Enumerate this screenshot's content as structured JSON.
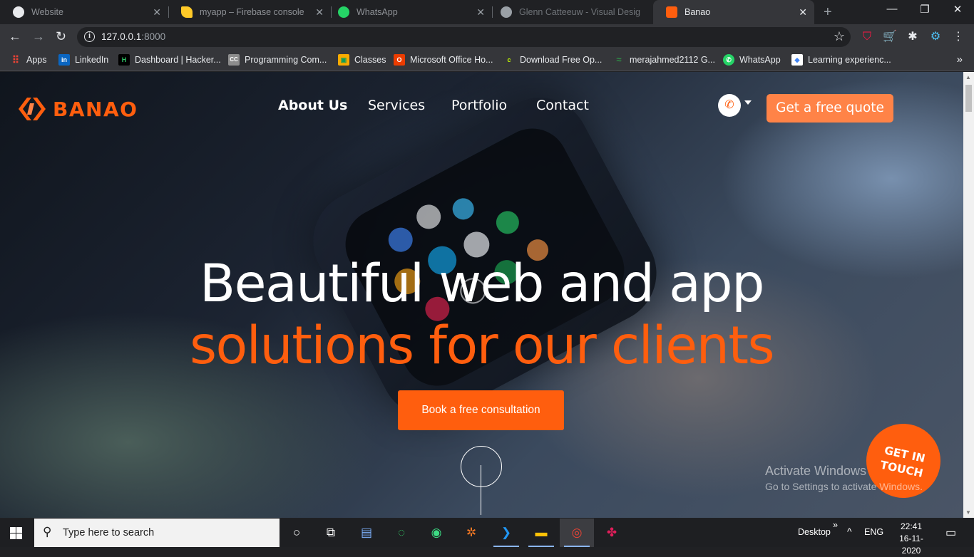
{
  "browser": {
    "tabs": [
      {
        "label": "Website",
        "favicon_color": "#e8eaed",
        "active": false
      },
      {
        "label": "myapp – Firebase console",
        "favicon_color": "#ffca28",
        "active": false
      },
      {
        "label": "WhatsApp",
        "favicon_color": "#25d366",
        "active": false
      },
      {
        "label": "Glenn Catteeuw - Visual Desig",
        "favicon_color": "#9aa0a6",
        "active": false
      },
      {
        "label": "Banao",
        "favicon_color": "#ff5e0e",
        "active": true
      }
    ],
    "close_glyph": "✕",
    "new_tab_glyph": "+",
    "window_controls": {
      "minimize": "—",
      "maximize": "❐",
      "close": "✕"
    },
    "nav": {
      "back": "←",
      "forward": "→",
      "reload": "↻"
    },
    "url_host": "127.0.0.1",
    "url_port": ":8000",
    "star_glyph": "☆",
    "extensions": [
      {
        "name": "shield-extension-icon",
        "glyph": "⛉",
        "color": "#ff1744"
      },
      {
        "name": "cart-extension-icon",
        "glyph": "🛒",
        "color": "#ff1744"
      },
      {
        "name": "puzzle-extension-icon",
        "glyph": "✱",
        "color": "#e8eaed"
      },
      {
        "name": "gear-extension-icon",
        "glyph": "⚙",
        "color": "#4fc3f7"
      },
      {
        "name": "menu-icon",
        "glyph": "⋮",
        "color": "#e8eaed"
      }
    ],
    "bookmarks": [
      {
        "label": "Apps",
        "icon_color": "#ea4335",
        "glyph": "⠿"
      },
      {
        "label": "LinkedIn",
        "icon_color": "#0a66c2",
        "glyph": "in"
      },
      {
        "label": "Dashboard | Hacker...",
        "icon_color": "#000000",
        "glyph": "H"
      },
      {
        "label": "Programming Com...",
        "icon_color": "#8d8d8d",
        "glyph": "CC"
      },
      {
        "label": "Classes",
        "icon_color": "#0f9d58",
        "glyph": "▣"
      },
      {
        "label": "Microsoft Office Ho...",
        "icon_color": "#eb3c00",
        "glyph": "O"
      },
      {
        "label": "Download Free Op...",
        "icon_color": "#35363a",
        "glyph": "c"
      },
      {
        "label": "merajahmed2112 G...",
        "icon_color": "#35363a",
        "glyph": "≈"
      },
      {
        "label": "WhatsApp",
        "icon_color": "#25d366",
        "glyph": "✆"
      },
      {
        "label": "Learning experienc...",
        "icon_color": "#ffffff",
        "glyph": "◆"
      }
    ],
    "bookmarks_more": "»"
  },
  "site": {
    "brand": "BANAO",
    "brand_color": "#ff5e0e",
    "nav": [
      "About Us",
      "Services",
      "Portfolio",
      "Contact"
    ],
    "phone_glyph": "✆",
    "quote_label": "Get a free quote",
    "hero_line1": "Beautiful web and app",
    "hero_line2": "solutions for our clients",
    "cta_label": "Book a free consultation",
    "get_in_touch_line1": "GET IN",
    "get_in_touch_line2": "TOUCH",
    "accent_color": "#ff5e0e"
  },
  "watermark": {
    "line1": "Activate Windows",
    "line2": "Go to Settings to activate Windows."
  },
  "taskbar": {
    "search_placeholder": "Type here to search",
    "search_glyph": "⚲",
    "cortana_glyph": "○",
    "taskview_glyph": "⧉",
    "apps": [
      {
        "name": "notepad-app-icon",
        "glyph": "▤",
        "color": "#7fb3ff"
      },
      {
        "name": "circle-app-icon",
        "glyph": "◌",
        "color": "#33cc66"
      },
      {
        "name": "android-studio-app-icon",
        "glyph": "◉",
        "color": "#3ddc84"
      },
      {
        "name": "xampp-app-icon",
        "glyph": "✲",
        "color": "#fb7a24"
      },
      {
        "name": "vscode-app-icon",
        "glyph": "❯",
        "color": "#2196f3"
      },
      {
        "name": "file-explorer-app-icon",
        "glyph": "▬",
        "color": "#ffc107"
      },
      {
        "name": "chrome-app-icon",
        "glyph": "◎",
        "color": "#ea4335"
      },
      {
        "name": "slack-app-icon",
        "glyph": "✤",
        "color": "#e01e5a"
      }
    ],
    "desktop_label": "Desktop",
    "chevron": "»",
    "tray_up": "^",
    "lang": "ENG",
    "time": "22:41",
    "date": "16-11-2020",
    "notification_glyph": "▭"
  }
}
